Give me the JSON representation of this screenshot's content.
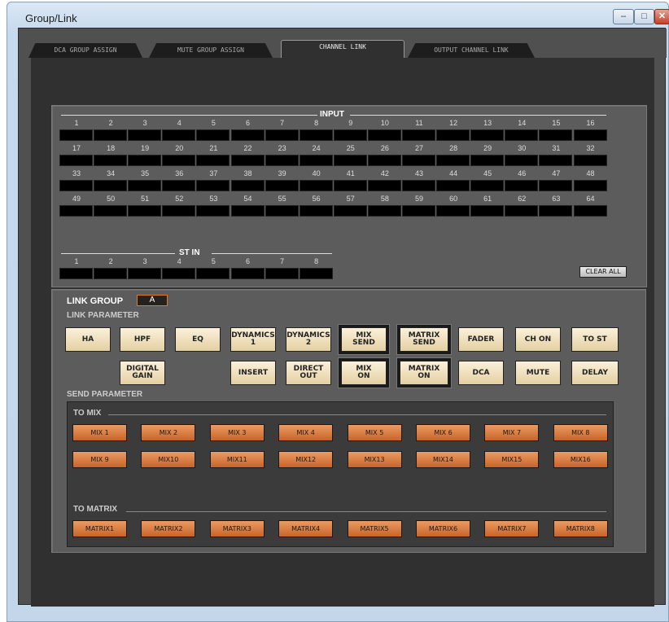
{
  "window": {
    "title": "Group/Link",
    "min_label": "–",
    "max_label": "□",
    "close_label": "✕"
  },
  "tabs": [
    {
      "label": "DCA GROUP ASSIGN"
    },
    {
      "label": "MUTE GROUP ASSIGN"
    },
    {
      "label": "CHANNEL LINK"
    },
    {
      "label": "OUTPUT CHANNEL LINK"
    }
  ],
  "input": {
    "title": "INPUT",
    "rows": [
      [
        "1",
        "2",
        "3",
        "4",
        "5",
        "6",
        "7",
        "8",
        "9",
        "10",
        "11",
        "12",
        "13",
        "14",
        "15",
        "16"
      ],
      [
        "17",
        "18",
        "19",
        "20",
        "21",
        "22",
        "23",
        "24",
        "25",
        "26",
        "27",
        "28",
        "29",
        "30",
        "31",
        "32"
      ],
      [
        "33",
        "34",
        "35",
        "36",
        "37",
        "38",
        "39",
        "40",
        "41",
        "42",
        "43",
        "44",
        "45",
        "46",
        "47",
        "48"
      ],
      [
        "49",
        "50",
        "51",
        "52",
        "53",
        "54",
        "55",
        "56",
        "57",
        "58",
        "59",
        "60",
        "61",
        "62",
        "63",
        "64"
      ]
    ],
    "st_title": "ST IN",
    "st": [
      "1",
      "2",
      "3",
      "4",
      "5",
      "6",
      "7",
      "8"
    ],
    "clear_all": "CLEAR ALL"
  },
  "link_group": {
    "label": "LINK GROUP",
    "value": "A"
  },
  "link_parameter": {
    "label": "LINK PARAMETER",
    "row1": [
      "HA",
      "HPF",
      "EQ",
      "DYNAMICS\n1",
      "DYNAMICS\n2",
      "MIX\nSEND",
      "MATRIX\nSEND",
      "FADER",
      "CH ON",
      "TO ST"
    ],
    "row2": [
      "DIGITAL\nGAIN",
      "INSERT",
      "DIRECT\nOUT",
      "MIX\nON",
      "MATRIX\nON",
      "DCA",
      "MUTE",
      "DELAY"
    ]
  },
  "send_parameter": {
    "label": "SEND PARAMETER",
    "to_mix_label": "TO MIX",
    "mix": [
      "MIX 1",
      "MIX 2",
      "MIX 3",
      "MIX 4",
      "MIX 5",
      "MIX 6",
      "MIX 7",
      "MIX 8",
      "MIX 9",
      "MIX10",
      "MIX11",
      "MIX12",
      "MIX13",
      "MIX14",
      "MIX15",
      "MIX16"
    ],
    "to_matrix_label": "TO MATRIX",
    "matrix": [
      "MATRIX1",
      "MATRIX2",
      "MATRIX3",
      "MATRIX4",
      "MATRIX5",
      "MATRIX6",
      "MATRIX7",
      "MATRIX8"
    ]
  },
  "colors": {
    "accent_orange": "#d8763a",
    "button_cream": "#f2e4c0",
    "panel_dark": "#303030"
  }
}
